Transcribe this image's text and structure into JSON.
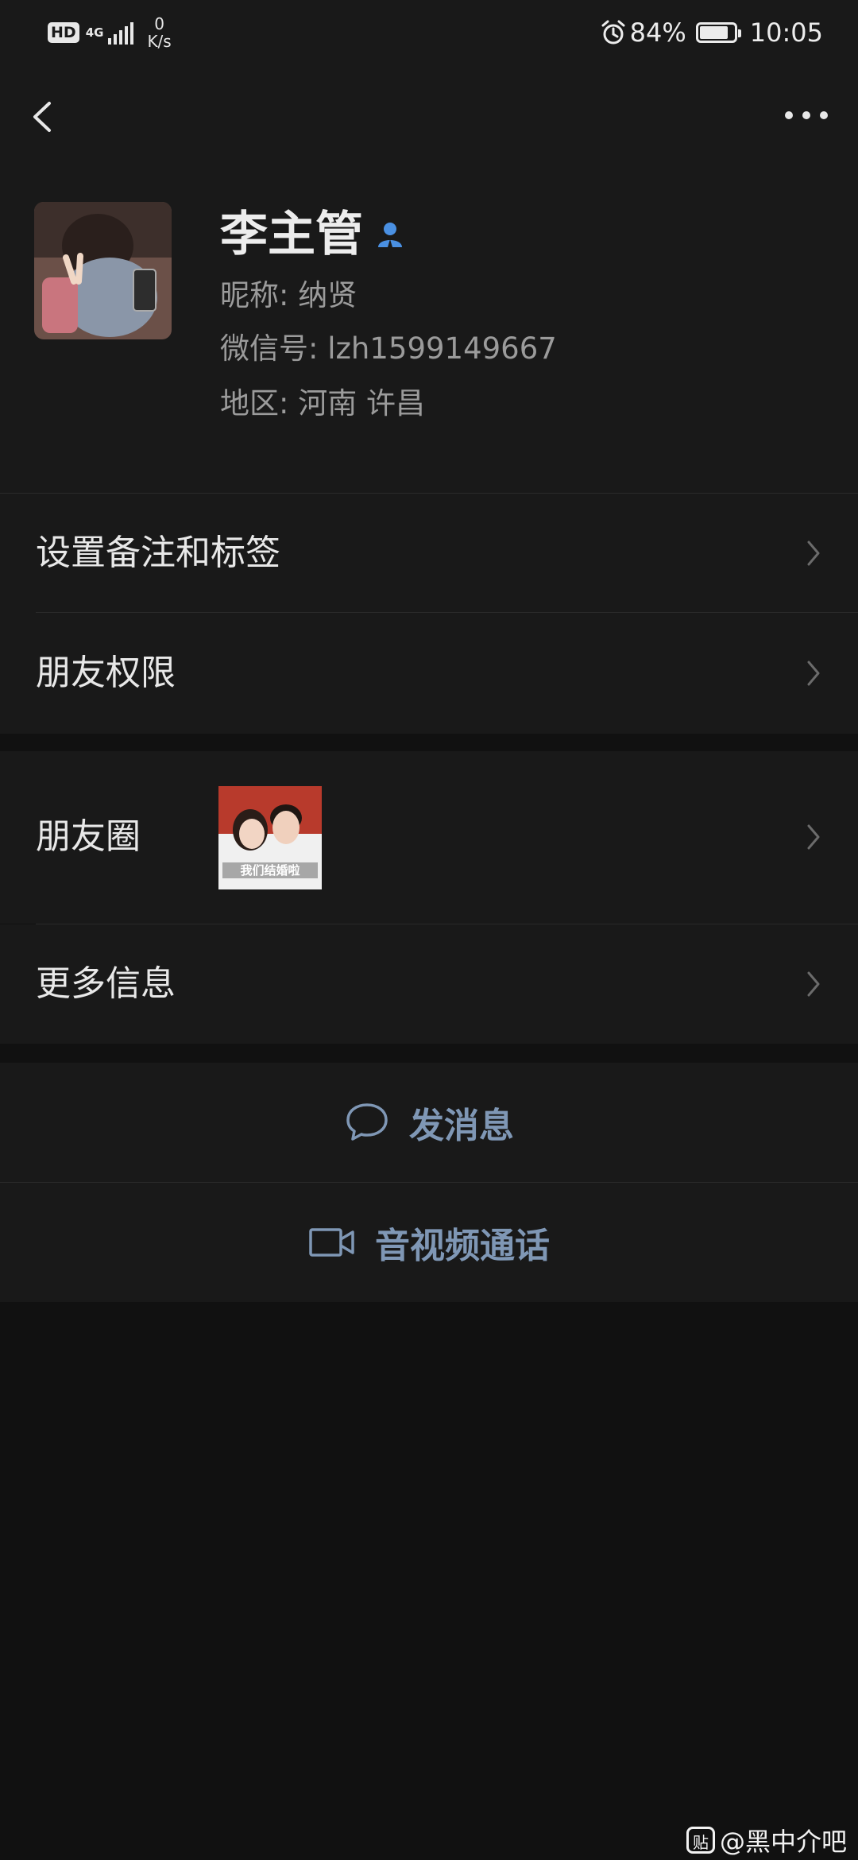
{
  "status_bar": {
    "hd": "HD",
    "network": "4G",
    "speed_value": "0",
    "speed_unit": "K/s",
    "battery_percent": "84%",
    "battery_level": 0.84,
    "time": "10:05"
  },
  "profile": {
    "name": "李主管",
    "nickname": "昵称: 纳贤",
    "wechat_id": "微信号: lzh1599149667",
    "region": "地区: 河南  许昌"
  },
  "menu": {
    "remark_tags": "设置备注和标签",
    "friend_permissions": "朋友权限",
    "moments": "朋友圈",
    "more_info": "更多信息"
  },
  "moments_thumb_caption": "我们结婚啦",
  "actions": {
    "send_message": "发消息",
    "video_call": "音视频通话"
  },
  "watermark": {
    "logo": "贴",
    "text": "@黑中介吧"
  },
  "colors": {
    "background": "#111111",
    "surface": "#191919",
    "action_text": "#7f97b5",
    "verified_icon": "#4a90e2"
  }
}
